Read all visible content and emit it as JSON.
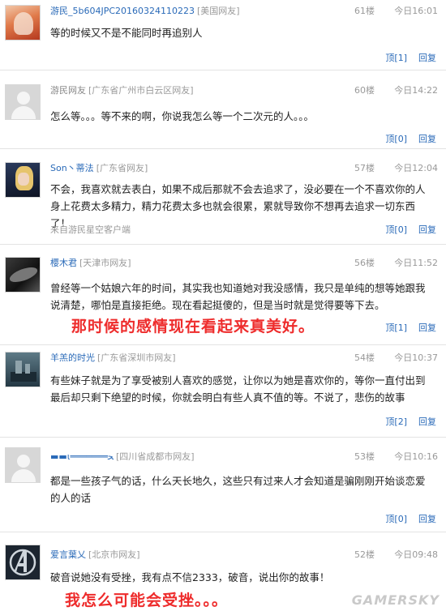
{
  "comments": [
    {
      "user": "游民_5b604JPC20160324110223",
      "location": "[美国网友]",
      "floor": "61楼",
      "time": "今日16:01",
      "text": "等的时候又不是不能同时再追别人",
      "source": "",
      "vote": "顶[1]",
      "reply": "回复"
    },
    {
      "user": "游民网友",
      "location": "[广东省广州市白云区网友]",
      "floor": "60楼",
      "time": "今日14:22",
      "text": "怎么等。。。等不来的啊，你说我怎么等一个二次元的人。。。",
      "source": "",
      "vote": "顶[0]",
      "reply": "回复"
    },
    {
      "user": "Son丶蒂法",
      "location": "[广东省网友]",
      "floor": "57楼",
      "time": "今日12:04",
      "text": "不会，我喜欢就去表白，如果不成后那就不会去追求了，没必要在一个不喜欢你的人身上花费太多精力，精力花费太多也就会很累，累就导致你不想再去追求一切东西了！",
      "source": "来自游民星空客户端",
      "vote": "顶[0]",
      "reply": "回复"
    },
    {
      "user": "樱木君",
      "location": "[天津市网友]",
      "floor": "56楼",
      "time": "今日11:52",
      "text": "曾经等一个姑娘六年的时间，其实我也知道她对我没感情，我只是单纯的想等她跟我说清楚，哪怕是直接拒绝。现在看起挺傻的，但是当时就是觉得要等下去。",
      "source": "",
      "vote": "顶[1]",
      "reply": "回复"
    },
    {
      "user": "羊羔的时光",
      "location": "[广东省深圳市网友]",
      "floor": "54楼",
      "time": "今日10:37",
      "text": "有些妹子就是为了享受被别人喜欢的感觉，让你以为她是喜欢你的，等你一直付出到最后却只剩下绝望的时候，你就会明白有些人真不值的等。不说了，悲伤的故事",
      "source": "",
      "vote": "顶[2]",
      "reply": "回复"
    },
    {
      "user": "▬▬ι═══════ﺤ",
      "location": "[四川省成都市网友]",
      "floor": "53楼",
      "time": "今日10:16",
      "text": "都是一些孩子气的话，什么天长地久，这些只有过来人才会知道是骗刚刚开始谈恋爱的人的话",
      "source": "",
      "vote": "顶[0]",
      "reply": "回复"
    },
    {
      "user": "爱言葉乂",
      "location": "[北京市网友]",
      "floor": "52楼",
      "time": "今日09:48",
      "text": "破音说她没有受挫，我有点不信2333，破音，说出你的故事！",
      "source": "",
      "vote": "",
      "reply": ""
    }
  ],
  "annotations": {
    "a1": "那时候的感情现在看起来真美好。",
    "a2": "我怎么可能会受挫。。。"
  },
  "watermark": "GAMERSKY"
}
